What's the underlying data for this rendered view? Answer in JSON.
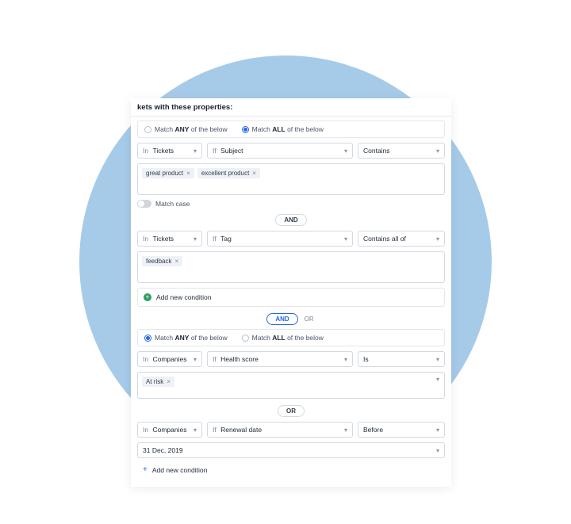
{
  "header": {
    "title_fragment": "kets with these properties:"
  },
  "labels": {
    "match_any_pre": "Match ",
    "match_any_bold": "ANY",
    "match_any_post": " of the below",
    "match_all_pre": "Match ",
    "match_all_bold": "ALL",
    "match_all_post": " of the below",
    "in_prefix": "In ",
    "if_prefix": "If ",
    "match_case": "Match case",
    "add_condition": "Add new condition",
    "and": "AND",
    "or": "OR"
  },
  "group1": {
    "selected_mode": "all",
    "cond1": {
      "scope": "Tickets",
      "field": "Subject",
      "operator": "Contains",
      "tags": [
        "great product",
        "excellent product"
      ]
    },
    "cond2": {
      "scope": "Tickets",
      "field": "Tag",
      "operator": "Contains all of",
      "tags": [
        "feedback"
      ]
    }
  },
  "between_groups": {
    "active": "AND"
  },
  "group2": {
    "selected_mode": "any",
    "cond1": {
      "scope": "Companies",
      "field": "Health score",
      "operator": "Is",
      "tags": [
        "At risk"
      ]
    },
    "cond2": {
      "scope": "Companies",
      "field": "Renewal date",
      "operator": "Before",
      "value": "31 Dec, 2019"
    }
  }
}
